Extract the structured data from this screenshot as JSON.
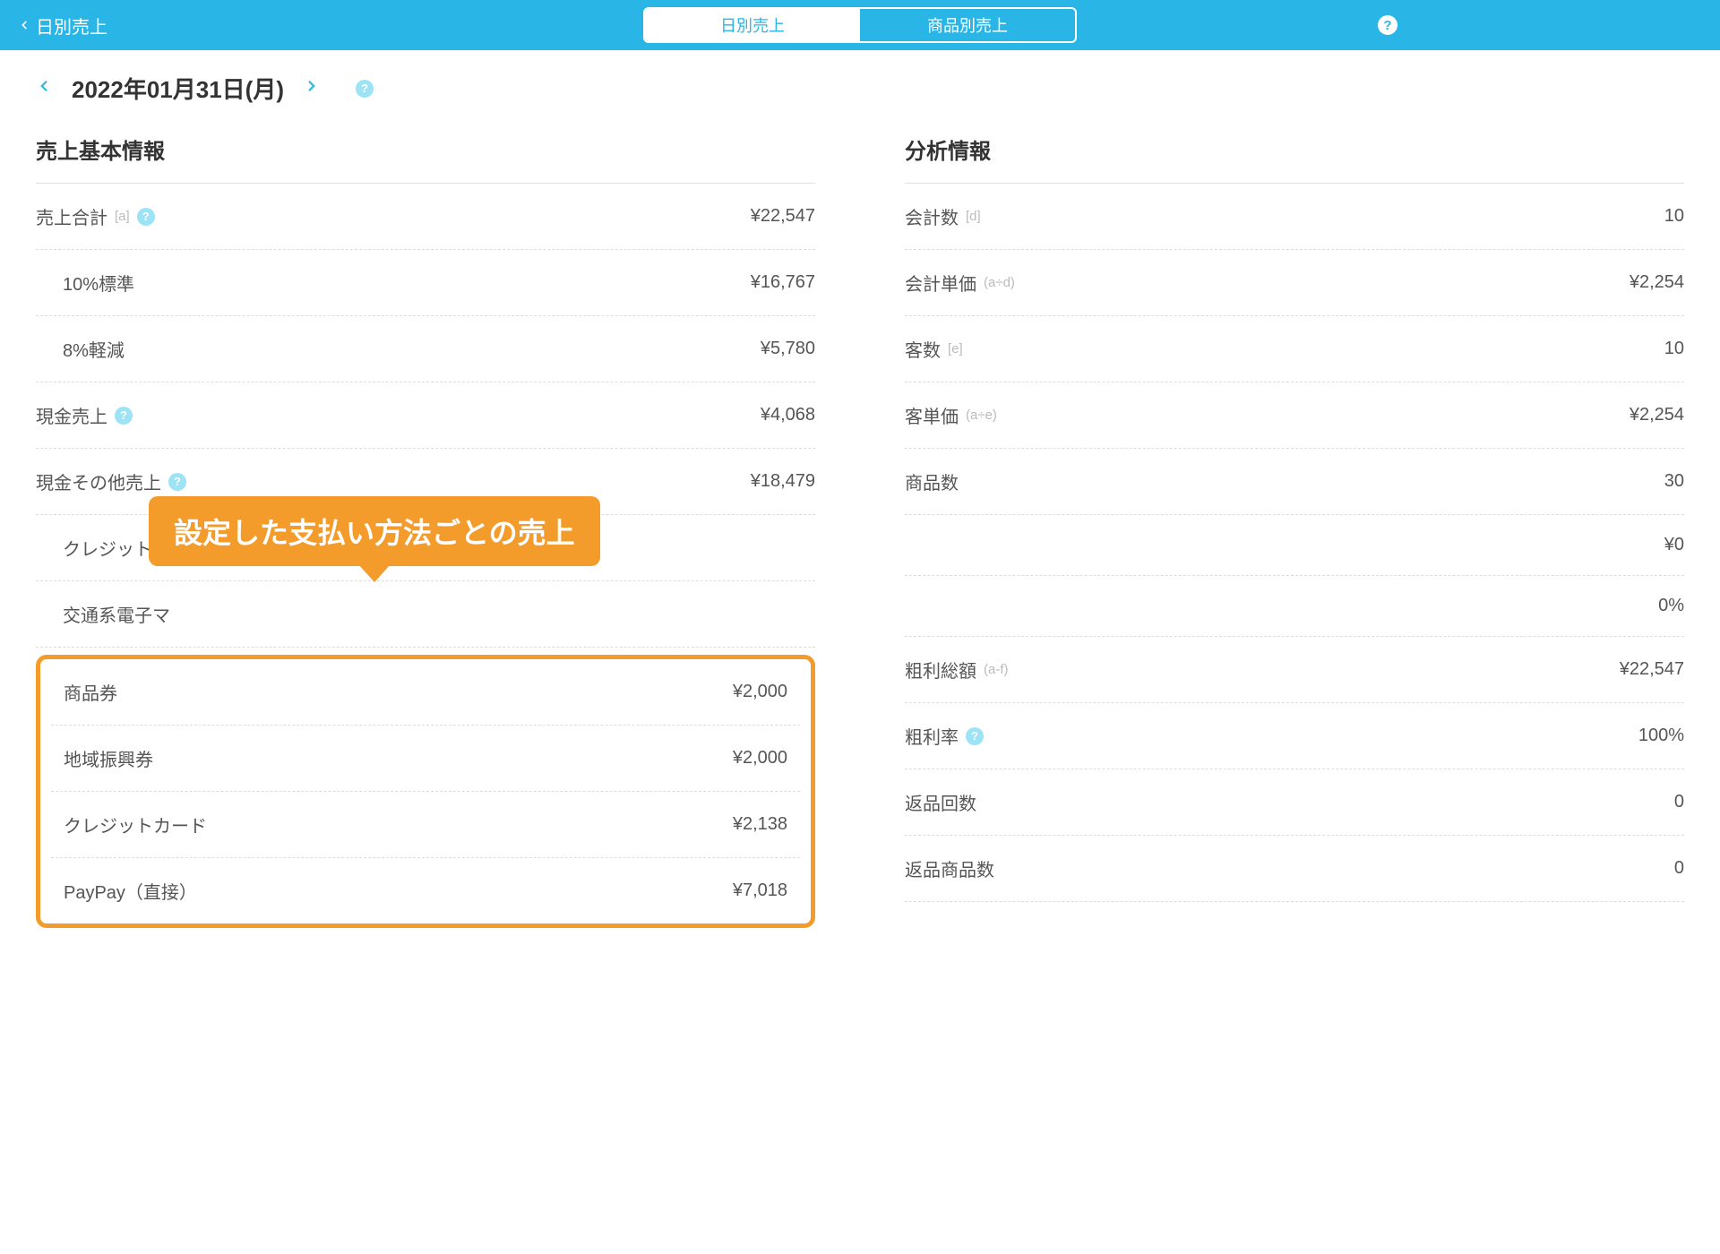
{
  "header": {
    "back_label": "日別売上",
    "tabs": [
      "日別売上",
      "商品別売上"
    ],
    "active_tab": 0
  },
  "date_nav": {
    "date": "2022年01月31日(月)"
  },
  "callout": "設定した支払い方法ごとの売上",
  "sales_basic": {
    "title": "売上基本情報",
    "rows": [
      {
        "label": "売上合計",
        "sub": "[a]",
        "value": "¥22,547",
        "help": true,
        "indent": false
      },
      {
        "label": "10%標準",
        "sub": "",
        "value": "¥16,767",
        "help": false,
        "indent": true
      },
      {
        "label": "8%軽減",
        "sub": "",
        "value": "¥5,780",
        "help": false,
        "indent": true
      },
      {
        "label": "現金売上",
        "sub": "",
        "value": "¥4,068",
        "help": true,
        "indent": false
      },
      {
        "label": "現金その他売上",
        "sub": "",
        "value": "¥18,479",
        "help": true,
        "indent": false
      },
      {
        "label": "クレジットカ",
        "sub": "",
        "value": "",
        "help": false,
        "indent": true
      },
      {
        "label": "交通系電子マ",
        "sub": "",
        "value": "",
        "help": false,
        "indent": true
      }
    ],
    "highlighted": [
      {
        "label": "商品券",
        "value": "¥2,000"
      },
      {
        "label": "地域振興券",
        "value": "¥2,000"
      },
      {
        "label": "クレジットカード",
        "value": "¥2,138"
      },
      {
        "label": "PayPay（直接）",
        "value": "¥7,018"
      }
    ]
  },
  "analysis": {
    "title": "分析情報",
    "rows": [
      {
        "label": "会計数",
        "sub": "[d]",
        "value": "10",
        "help": false
      },
      {
        "label": "会計単価",
        "sub": "(a÷d)",
        "value": "¥2,254",
        "help": false
      },
      {
        "label": "客数",
        "sub": "[e]",
        "value": "10",
        "help": false
      },
      {
        "label": "客単価",
        "sub": "(a÷e)",
        "value": "¥2,254",
        "help": false
      },
      {
        "label": "商品数",
        "sub": "",
        "value": "30",
        "help": false
      },
      {
        "label": "",
        "sub": "",
        "value": "¥0",
        "help": false
      },
      {
        "label": "",
        "sub": "",
        "value": "0%",
        "help": false
      },
      {
        "label": "粗利総額",
        "sub": "(a-f)",
        "value": "¥22,547",
        "help": false
      },
      {
        "label": "粗利率",
        "sub": "",
        "value": "100%",
        "help": true
      },
      {
        "label": "返品回数",
        "sub": "",
        "value": "0",
        "help": false
      },
      {
        "label": "返品商品数",
        "sub": "",
        "value": "0",
        "help": false
      }
    ]
  }
}
